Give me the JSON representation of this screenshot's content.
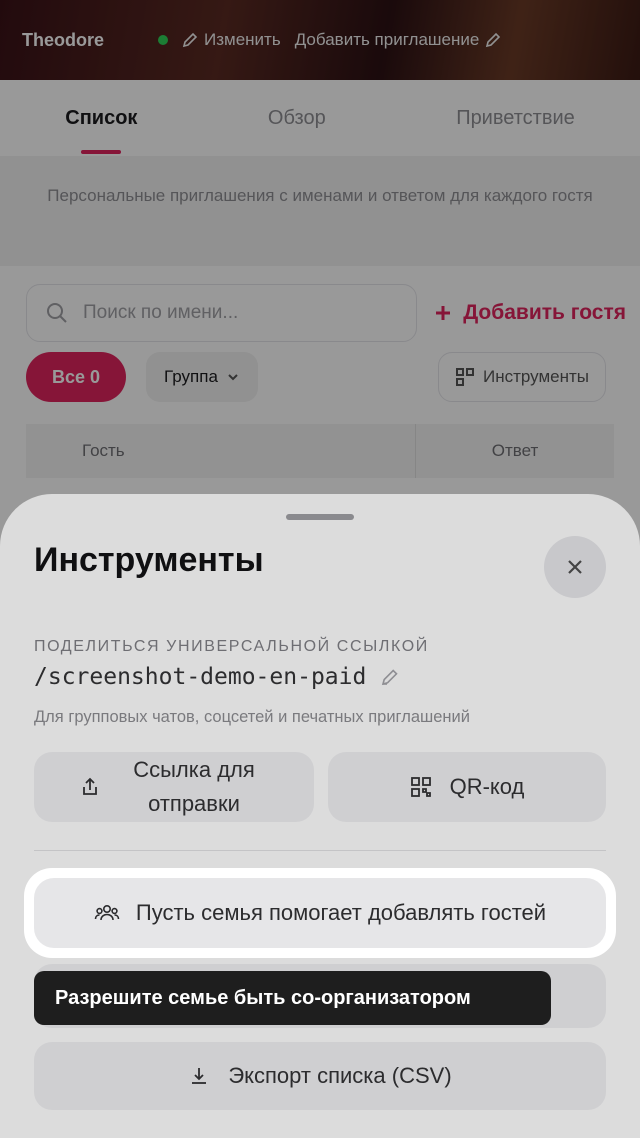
{
  "topbar": {
    "name": "Theodore",
    "edit_label": "Изменить",
    "add_invite_label": "Добавить приглашение"
  },
  "tabs": [
    {
      "label": "Список",
      "active": true
    },
    {
      "label": "Обзор",
      "active": false
    },
    {
      "label": "Приветствие",
      "active": false
    }
  ],
  "info_text": "Персональные приглашения с именами и ответом для каждого гостя",
  "search": {
    "placeholder": "Поиск по имени..."
  },
  "add_guest_label": "Добавить гостя",
  "filters": {
    "all_label": "Все 0",
    "group_label": "Группа",
    "tools_label": "Инструменты"
  },
  "table": {
    "columns": [
      "Гость",
      "Ответ"
    ]
  },
  "sheet": {
    "title": "Инструменты",
    "share_label": "ПОДЕЛИТЬСЯ УНИВЕРСАЛЬНОЙ ССЫЛКОЙ",
    "share_link": "/screenshot-demo-en-paid",
    "share_hint": "Для групповых чатов, соцсетей и печатных приглашений",
    "send_link_label": "Ссылка для отправки",
    "qr_label": "QR-код",
    "family_label": "Пусть семья помогает добавлять гостей",
    "export_label": "Экспорт списка (CSV)"
  },
  "tooltip": {
    "text": "Разрешите семье быть со-организатором"
  },
  "colors": {
    "accent": "#e0245e",
    "sheet_bg": "#dcdcdc",
    "tooltip_bg": "#1e1e1e"
  }
}
